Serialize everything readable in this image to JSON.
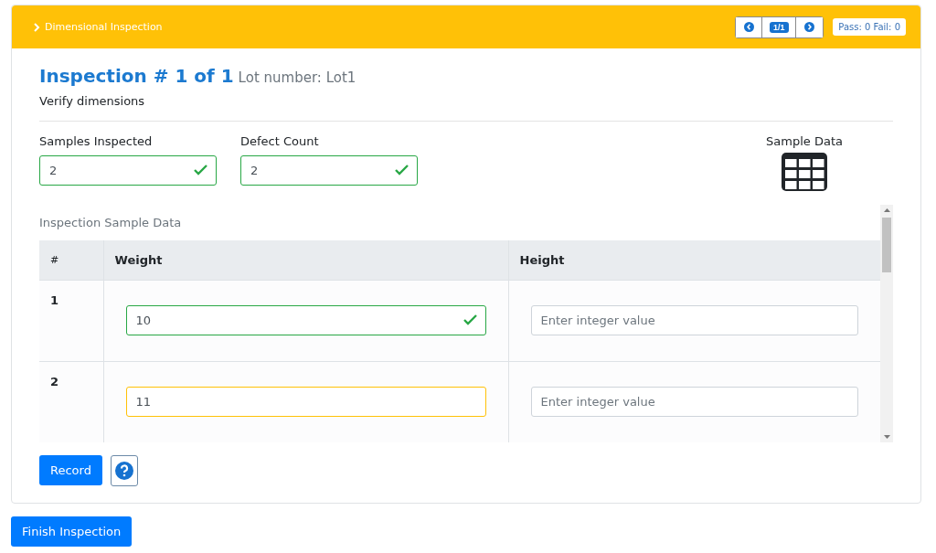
{
  "header": {
    "title": "Dimensional Inspection",
    "pager": {
      "current": "1/1"
    },
    "summary": "Pass: 0 Fail: 0"
  },
  "inspection": {
    "title": "Inspection # 1 of 1",
    "lot": "Lot number: Lot1",
    "description": "Verify dimensions"
  },
  "fields": [
    {
      "label": "Samples Inspected",
      "value": "2",
      "valid": true,
      "warning": false
    },
    {
      "label": "Defect Count",
      "value": "2",
      "valid": true,
      "warning": false
    }
  ],
  "sample_data_link": {
    "label": "Sample Data"
  },
  "table": {
    "caption": "Inspection Sample Data",
    "columns": [
      "#",
      "Weight",
      "Height"
    ],
    "rows": [
      {
        "cells": [
          {
            "kind": "index",
            "text": "1"
          },
          {
            "kind": "input",
            "value": "10",
            "valid": true,
            "warning": false
          },
          {
            "kind": "input",
            "placeholder": "Enter integer value",
            "valid": false,
            "warning": false
          }
        ]
      },
      {
        "cells": [
          {
            "kind": "index",
            "text": "2"
          },
          {
            "kind": "input",
            "value": "11",
            "valid": false,
            "warning": true
          },
          {
            "kind": "input",
            "placeholder": "Enter integer value",
            "valid": false,
            "warning": false
          }
        ]
      }
    ]
  },
  "buttons": {
    "record": "Record",
    "finish": "Finish Inspection"
  }
}
